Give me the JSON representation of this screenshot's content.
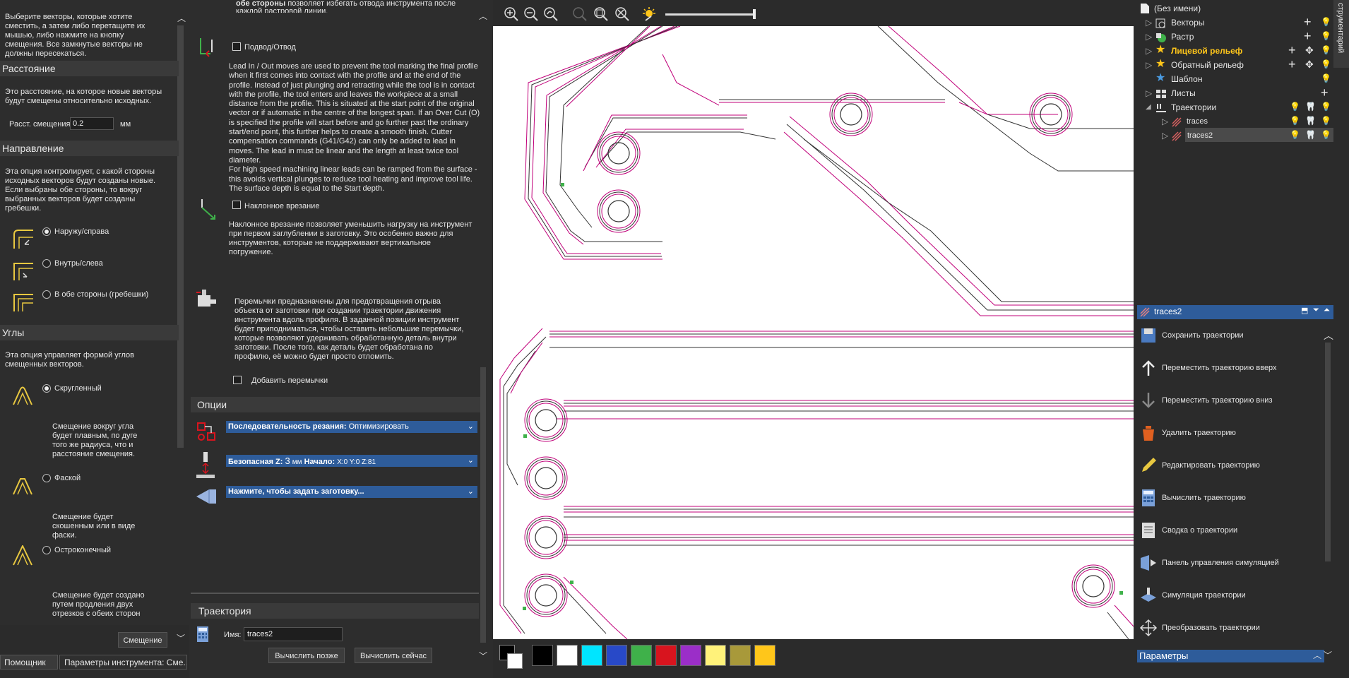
{
  "left": {
    "intro": "Выберите векторы, которые хотите сместить, а затем либо перетащите их мышью, либо нажмите на кнопку смещения. Все замкнутые векторы не должны пересекаться.",
    "distance": {
      "header": "Расстояние",
      "desc": "Это расстояние, на которое новые векторы будут смещены относительно исходных.",
      "label": "Расст. смещения",
      "value": "0.2",
      "unit": "мм"
    },
    "direction": {
      "header": "Направление",
      "desc": "Эта опция контролирует, с какой стороны исходных векторов будут созданы новые. Если выбраны обе стороны, то вокруг выбранных векторов будет созданы гребешки.",
      "options": [
        "Наружу/справа",
        "Внутрь/слева",
        "В обе стороны (гребешки)"
      ],
      "selected": 0
    },
    "corners": {
      "header": "Углы",
      "desc": "Эта опция управляет формой углов смещенных векторов.",
      "rounded": "Скругленный",
      "rounded_desc": "Смещение вокруг угла будет плавным, по дуге того же радиуса, что и расстояние смещения.",
      "chamfer": "Фаской",
      "chamfer_desc": "Смещение будет скошенным или в виде фаски.",
      "sharp": "Остроконечный",
      "sharp_desc": "Смещение будет создано путем продления двух отрезков с обеих сторон угла до точки их пересечения. Эта опция может"
    },
    "offset_button": "Смещение"
  },
  "mid": {
    "top_text_bold": "обе стороны",
    "top_text": "позволяет избегать отвода инструмента после каждой растровой линии.",
    "leadin_label": "Подвод/Отвод",
    "leadin_desc": "Lead In / Out moves are used to prevent the tool marking the final profile when it first comes into contact with the profile and at the end of the profile. Instead of just plunging and retracting while the tool is in contact with the profile, the tool enters and leaves the workpiece at a small distance from the profile. This is situated at the start point of the original vector or if automatic in the centre of the longest span. If an Over Cut (O) is specified the profile will start before and go further past the ordinary start/end point, this further helps to create a smooth finish. Cutter compensation commands (G41/G42) can only be added to lead in moves. The lead in must be linear and the length at least twice tool diameter.",
    "leadin_desc2": "For high speed machining linear leads can be ramped from the surface - this avoids vertical plunges to reduce tool heating and improve tool life. The surface depth is equal to the Start depth.",
    "ramp_label": "Наклонное врезание",
    "ramp_desc": "Наклонное врезание позволяет уменьшить нагрузку на инструмент при первом заглублении в заготовку. Это особенно важно для инструментов, которые не поддерживают вертикальное погружение.",
    "tabs_desc": "Перемычки предназначены для предотвращения отрыва объекта от заготовки при создании траектории движения инструмента вдоль профиля. В заданной позиции инструмент будет приподниматься, чтобы оставить небольшие перемычки, которые позволяют удерживать обработанную деталь внутри заготовки. После того, как деталь будет обработана по профилю, её можно будет просто отломить.",
    "tabs_label": "Добавить перемычки",
    "options_header": "Опции",
    "cut_order_label": "Последовательность резания:",
    "cut_order_value": "Оптимизировать",
    "safe_z_label": "Безопасная Z:",
    "safe_z_value": "3",
    "safe_z_unit": "мм",
    "start_label": "Начало:",
    "start_value": "X:0 Y:0 Z:81",
    "stock_label": "Нажмите, чтобы задать заготовку...",
    "toolpath_header": "Траектория",
    "name_label": "Имя:",
    "name_value": "traces2",
    "calc_later": "Вычислить позже",
    "calc_now": "Вычислить сейчас"
  },
  "bottom_tabs": [
    "Помощник",
    "Параметры инструмента: Сме..."
  ],
  "tree": {
    "root": "(Без имени)",
    "items": [
      "Векторы",
      "Растр",
      "Лицевой рельеф",
      "Обратный рельеф",
      "Шаблон",
      "Листы",
      "Траектории",
      "traces",
      "traces2"
    ]
  },
  "toolpath_panel": {
    "title": "traces2",
    "ops": [
      "Сохранить траектории",
      "Переместить траекторию вверх",
      "Переместить траекторию вниз",
      "Удалить траекторию",
      "Редактировать траекторию",
      "Вычислить траекторию",
      "Сводка о траектории",
      "Панель управления симуляцией",
      "Симуляция траектории",
      "Преобразовать траектории"
    ],
    "params_header": "Параметры"
  },
  "side_tab": "струментарий",
  "colors": {
    "accent_blue": "#2e5c9a",
    "trace_magenta": "#c0007a",
    "palette": [
      "#000000",
      "#ffffff",
      "#00e5ff",
      "#2849c8",
      "#3fb14a",
      "#d8141e",
      "#9b2ec8",
      "#fff27a",
      "#a8993a",
      "#ffc61a"
    ]
  }
}
